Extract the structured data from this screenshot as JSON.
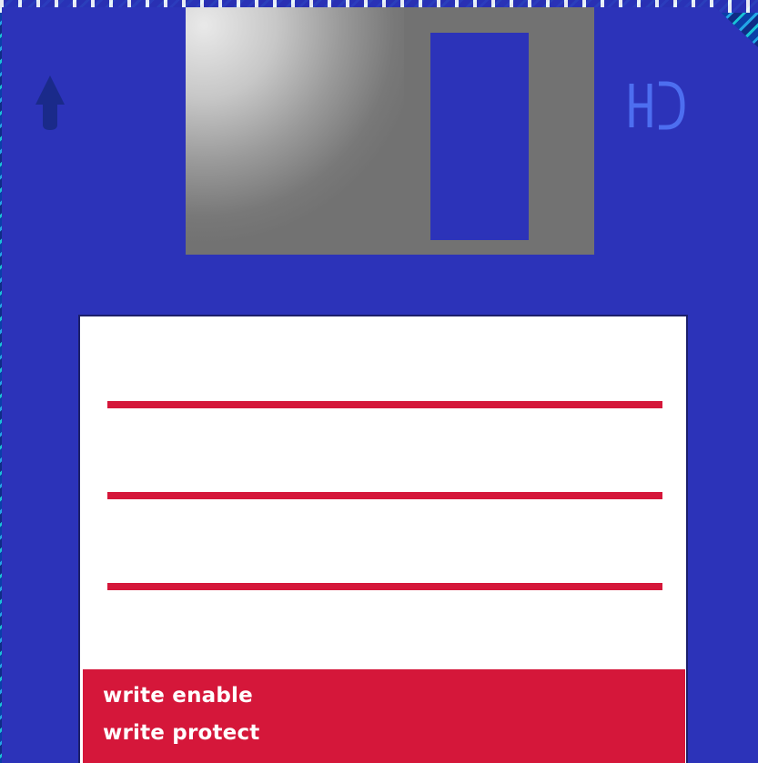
{
  "disk": {
    "type": "floppy-disk",
    "density_mark": "HD",
    "label_lines": 3,
    "legend": {
      "enable": "write enable",
      "protect": "write protect"
    },
    "colors": {
      "body": "#2c33b9",
      "shutter": "#727272",
      "label": "#ffffff",
      "accent": "#d5173a",
      "mark": "#4d6ef0"
    },
    "icons": [
      "insert-arrow-icon",
      "hd-mark"
    ]
  }
}
